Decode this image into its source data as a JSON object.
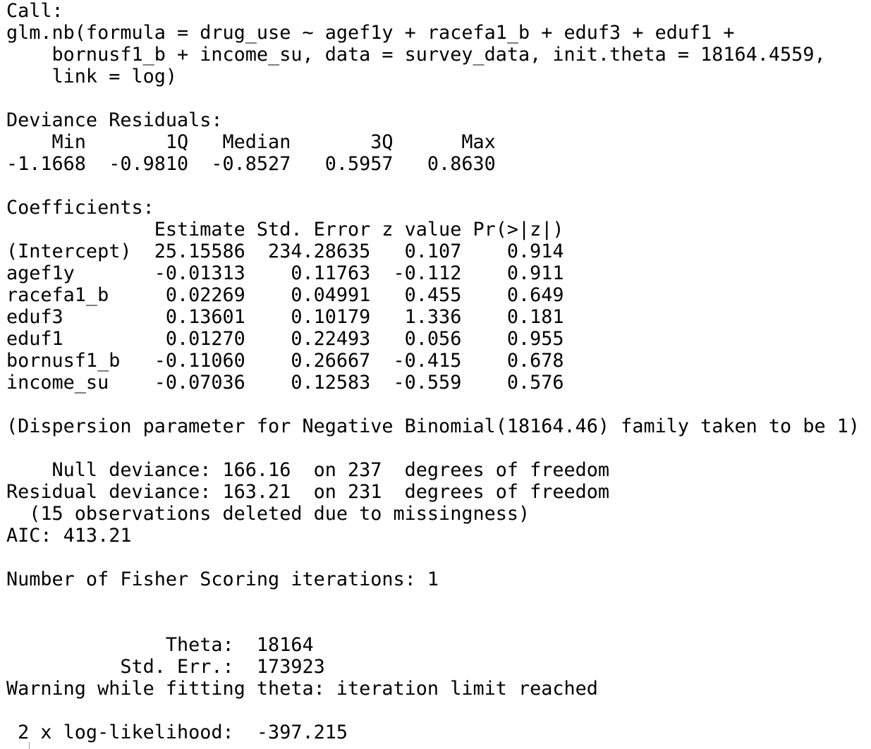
{
  "console": {
    "lines": [
      "Call:",
      "glm.nb(formula = drug_use ~ agef1y + racefa1_b + eduf3 + eduf1 + ",
      "    bornusf1_b + income_su, data = survey_data, init.theta = 18164.4559, ",
      "    link = log)",
      "",
      "Deviance Residuals: ",
      "    Min       1Q   Median       3Q      Max  ",
      "-1.1668  -0.9810  -0.8527   0.5957   0.8630  ",
      "",
      "Coefficients:",
      "             Estimate Std. Error z value Pr(>|z|)",
      "(Intercept)  25.15586  234.28635   0.107    0.914",
      "agef1y       -0.01313    0.11763  -0.112    0.911",
      "racefa1_b     0.02269    0.04991   0.455    0.649",
      "eduf3         0.13601    0.10179   1.336    0.181",
      "eduf1         0.01270    0.22493   0.056    0.955",
      "bornusf1_b   -0.11060    0.26667  -0.415    0.678",
      "income_su    -0.07036    0.12583  -0.559    0.576",
      "",
      "(Dispersion parameter for Negative Binomial(18164.46) family taken to be 1)",
      "",
      "    Null deviance: 166.16  on 237  degrees of freedom",
      "Residual deviance: 163.21  on 231  degrees of freedom",
      "  (15 observations deleted due to missingness)",
      "AIC: 413.21",
      "",
      "Number of Fisher Scoring iterations: 1",
      "",
      "",
      "              Theta:  18164 ",
      "          Std. Err.:  173923 ",
      "Warning while fitting theta: iteration limit reached ",
      "",
      " 2 x log-likelihood:  -397.215 "
    ]
  }
}
